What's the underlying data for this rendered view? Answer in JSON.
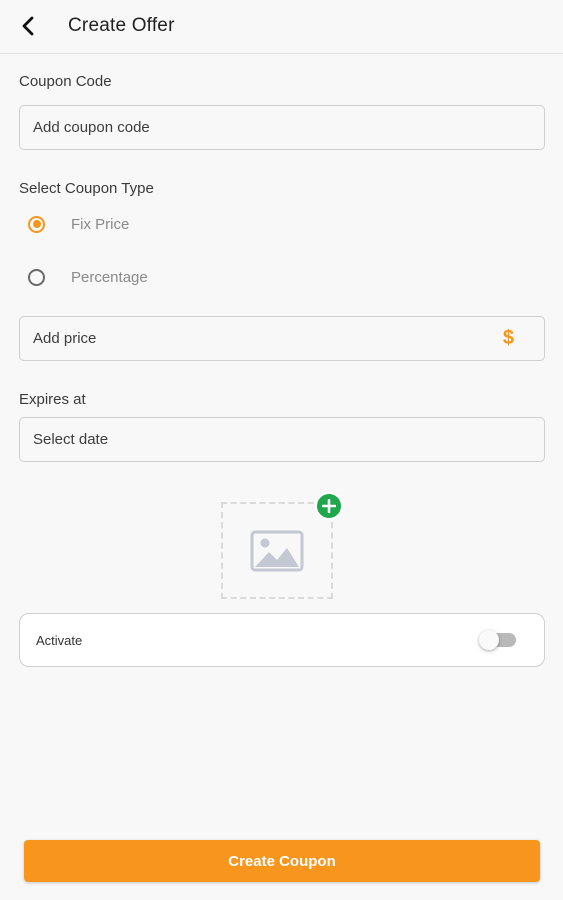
{
  "header": {
    "title": "Create Offer",
    "back_icon": "arrow-back-icon"
  },
  "coupon_code": {
    "label": "Coupon Code",
    "placeholder": "Add coupon code",
    "value": ""
  },
  "coupon_type": {
    "label": "Select Coupon Type",
    "options": [
      {
        "label": "Fix Price",
        "selected": true
      },
      {
        "label": "Percentage",
        "selected": false
      }
    ]
  },
  "price": {
    "placeholder": "Add price",
    "value": "",
    "suffix": "$"
  },
  "expires": {
    "label": "Expires at",
    "placeholder": "Select date",
    "value": ""
  },
  "image_picker": {
    "placeholder_icon": "image-placeholder-icon",
    "add_icon": "plus-icon"
  },
  "activate": {
    "label": "Activate",
    "enabled": false
  },
  "submit": {
    "label": "Create Coupon"
  },
  "colors": {
    "accent": "#f7951d",
    "add_green": "#1ea84b",
    "toggle_off": "#b9b9b9"
  }
}
